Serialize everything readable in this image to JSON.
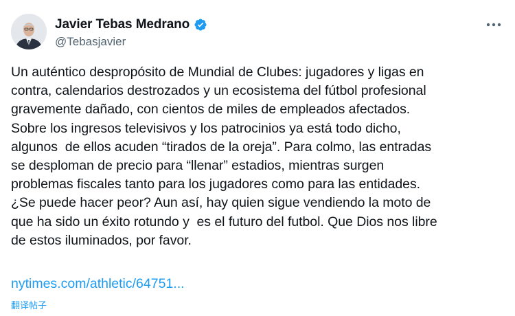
{
  "author": {
    "display_name": "Javier Tebas Medrano",
    "handle": "@Tebasjavier",
    "verified_icon": "verified-badge-icon",
    "verified_color": "#1d9bf0"
  },
  "tweet": {
    "lines": [
      "Un auténtico despropósito de Mundial de Clubes: jugadores y ligas en",
      "contra, calendarios destrozados y un ecosistema del fútbol profesional",
      "gravemente dañado, con cientos de miles de empleados afectados.",
      "Sobre los ingresos televisivos y los patrocinios ya está todo dicho,",
      "algunos  de ellos acuden “tirados de la oreja”. Para colmo, las entradas",
      "se desploman de precio para “llenar” estadios, mientras surgen",
      "problemas fiscales tanto para los jugadores como para las entidades.",
      "¿Se puede hacer peor? Aun así, hay quien sigue vendiendo la moto de",
      "que ha sido un éxito rotundo y  es el futuro del futbol. Que Dios nos libre",
      "de estos iluminados, por favor."
    ],
    "link_text": "nytimes.com/athletic/64751...",
    "link_color": "#1d9bf0",
    "translate_label": "翻译帖子"
  },
  "icons": {
    "more": "more-options-icon",
    "avatar": "avatar"
  }
}
